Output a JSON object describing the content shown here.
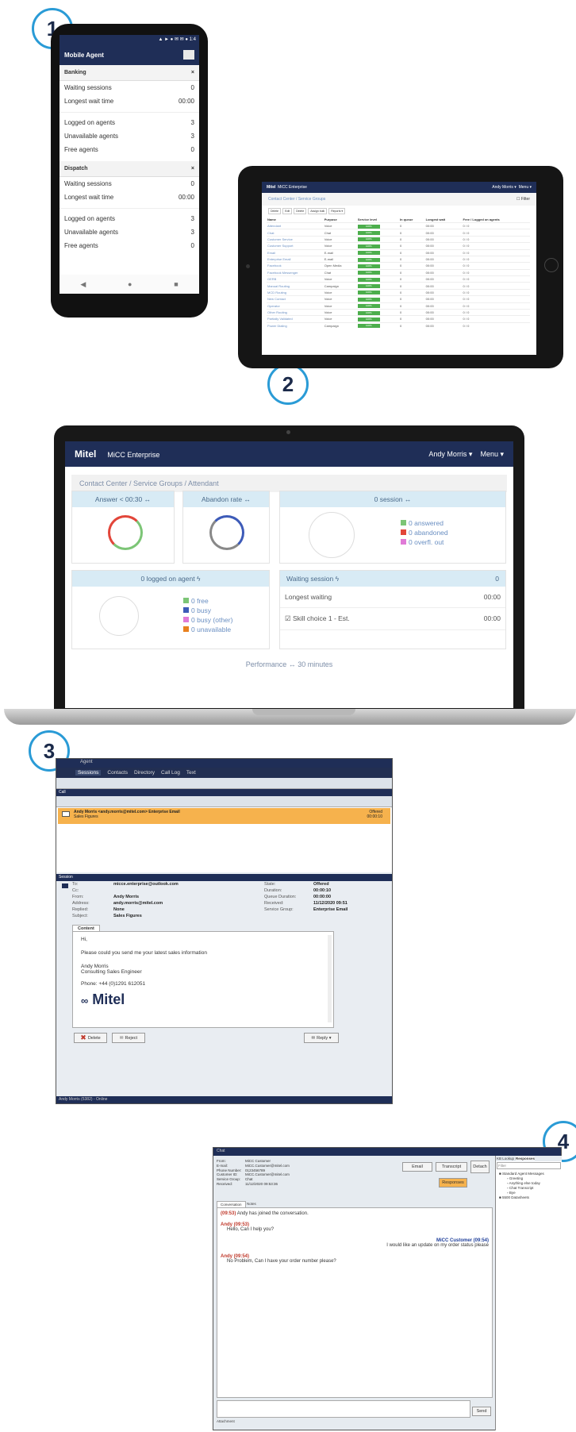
{
  "badges": [
    "1",
    "2",
    "3",
    "4"
  ],
  "phone": {
    "status": "▲ ► ● ✉ ✉ ● 1:4",
    "title": "Mobile Agent",
    "sections": [
      {
        "name": "Banking",
        "rows_a": [
          [
            "Waiting sessions",
            "0"
          ],
          [
            "Longest wait time",
            "00:00"
          ]
        ],
        "rows_b": [
          [
            "Logged on agents",
            "3"
          ],
          [
            "Unavailable agents",
            "3"
          ],
          [
            "Free agents",
            "0"
          ]
        ]
      },
      {
        "name": "Dispatch",
        "rows_a": [
          [
            "Waiting sessions",
            "0"
          ],
          [
            "Longest wait time",
            "00:00"
          ]
        ],
        "rows_b": [
          [
            "Logged on agents",
            "3"
          ],
          [
            "Unavailable agents",
            "3"
          ],
          [
            "Free agents",
            "0"
          ]
        ]
      }
    ],
    "nav": [
      "◀",
      "●",
      "■"
    ],
    "close": "×"
  },
  "tablet": {
    "brand": "Mitel",
    "product": "MiCC Enterprise",
    "user": "Andy Morris ▾",
    "menu": "Menu ▾",
    "crumb": "Contact Center / Service Groups",
    "filter": "☐ Filter",
    "buttons": [
      "Delete",
      "Edit",
      "Delete",
      "Assign bulk",
      "Reports ▾"
    ],
    "columns": [
      "Name",
      "Purpose",
      "Service level",
      "In queue",
      "Longest wait",
      "Free / Logged on agents"
    ],
    "rows": [
      [
        "Attendant",
        "Voice"
      ],
      [
        "Chat",
        "Chat"
      ],
      [
        "Customer Service",
        "Voice"
      ],
      [
        "Customer Support",
        "Voice"
      ],
      [
        "Email",
        "E-mail"
      ],
      [
        "Enterprise Email",
        "E-mail"
      ],
      [
        "Facebook",
        "Open Media"
      ],
      [
        "Facebook Messenger",
        "Chat"
      ],
      [
        "GERB",
        "Voice"
      ],
      [
        "Manual Routing",
        "Campaign"
      ],
      [
        "MCD Routing",
        "Voice"
      ],
      [
        "New Contact",
        "Voice"
      ],
      [
        "Operator",
        "Voice"
      ],
      [
        "Other Routing",
        "Voice"
      ],
      [
        "Partially Validated",
        "Voice"
      ],
      [
        "Power Dialing",
        "Campaign"
      ]
    ],
    "row_sl": "100%",
    "row_q": "0",
    "row_wait": "00:00",
    "row_agents": "0 / 0"
  },
  "laptop": {
    "brand": "Mitel",
    "product": "MiCC Enterprise",
    "user": "Andy Morris ▾",
    "menu": "Menu ▾",
    "crumb": "Contact Center  /  Service Groups  /  Attendant",
    "card_answer": "Answer < 00:30  ↔",
    "card_abandon": "Abandon rate  ↔",
    "card_session": "0 session  ↔",
    "session_legend": [
      "0 answered",
      "0 abandoned",
      "0 overfl. out"
    ],
    "card_logged": "0 logged on agent  ϟ",
    "logged_legend": [
      "0 free",
      "0 busy",
      "0 busy (other)",
      "0 unavailable"
    ],
    "waiting_title": "Waiting session  ϟ",
    "waiting_count": "0",
    "longest_label": "Longest waiting",
    "longest_value": "00:00",
    "skill_label": "☑ Skill choice 1 - Est.",
    "skill_value": "00:00",
    "performance": "Performance  ↔  30 minutes",
    "colors": {
      "green": "#7cc576",
      "red": "#e2463a",
      "pink": "#e07ad7",
      "blue": "#3d5bb8",
      "orange": "#e8801e"
    }
  },
  "agent": {
    "title": "Agent",
    "menu": [
      "Sessions",
      "Contacts",
      "Directory",
      "Call Log",
      "Text"
    ],
    "call_label": "Call",
    "email_from": "Andy Morris <andy.morris@mitel.com>  Enterprise Email",
    "email_subject": "Sales Figures",
    "email_status": "Offered",
    "email_time": "00:00:10",
    "session_label": "Session",
    "fields": [
      [
        "To:",
        "micce.enterprise@outlook.com"
      ],
      [
        "Cc:",
        ""
      ],
      [
        "From:",
        "Andy Morris"
      ],
      [
        "Address:",
        "andy.morris@mitel.com"
      ],
      [
        "Replied:",
        "None"
      ],
      [
        "Subject:",
        "Sales Figures"
      ]
    ],
    "fields2": [
      [
        "State:",
        "Offered"
      ],
      [
        "Duration:",
        "00:00:10"
      ],
      [
        "Queue Duration:",
        "00:00:00"
      ],
      [
        "Received:",
        "11/12/2020 09:51"
      ],
      [
        "Service Group:",
        "Enterprise Email"
      ]
    ],
    "content_tab": "Content",
    "body": [
      "Hi,",
      "Please could you send me your latest sales information",
      "Andy Morris",
      "Consulting Sales Engineer",
      "Phone: +44 (0)1291 612051"
    ],
    "logo": "Mitel",
    "delete": "Delete",
    "reject": "Reject",
    "reply": "Reply ▾",
    "status": "Andy Morris (5382) - Online"
  },
  "chat": {
    "title": "Chat",
    "info": [
      [
        "From:",
        "MiCC Customer"
      ],
      [
        "E-mail:",
        "MiCC.Customer@mitel.com"
      ],
      [
        "Phone Number:",
        "0123456789"
      ],
      [
        "Customer ID:",
        "MiCC.Customer@mitel.com"
      ],
      [
        "Service Group:",
        "Chat"
      ],
      [
        "Received:",
        "11/12/2020 09:53:36"
      ]
    ],
    "email_btn": "Email",
    "transcript_btn": "Transcript",
    "detach_btn": "Detach",
    "responses_btn": "Responses",
    "tabs": [
      "Conversation",
      "Notes"
    ],
    "lines": [
      {
        "who": "(09:53)",
        "text": "Andy has joined the conversation."
      },
      {
        "who": "Andy (09:53)",
        "text": "Hello, Can I help you?"
      },
      {
        "who": "MiCC Customer (09:54)",
        "text": "I would like an update on my order status please"
      },
      {
        "who": "Andy (09:54)",
        "text": "No Problem, Can I have your order number please?"
      }
    ],
    "send": "Send",
    "attachment": "Attachment",
    "side_tabs": [
      "KB Lookup",
      "Responses"
    ],
    "filter": "Filter",
    "tree": [
      "Standard Agent Messages",
      "Greeting",
      "Anything else today",
      "Chat Transcript",
      "Bye",
      "5500 Datasheets"
    ]
  }
}
